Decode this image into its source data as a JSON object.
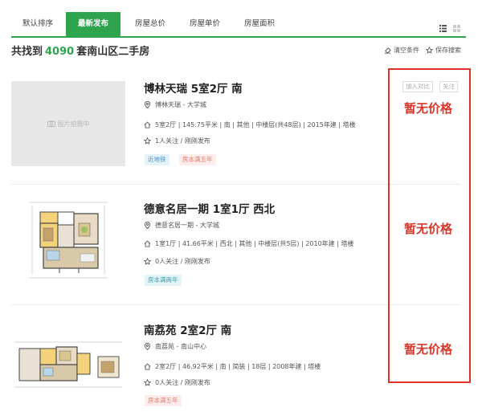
{
  "sort_tabs": [
    {
      "label": "默认排序"
    },
    {
      "label": "最新发布"
    },
    {
      "label": "房屋总价"
    },
    {
      "label": "房屋单价"
    },
    {
      "label": "房屋面积"
    }
  ],
  "summary": {
    "prefix": "共找到",
    "count": "4090",
    "suffix": "套南山区二手房"
  },
  "tools": {
    "clear": "清空条件",
    "save": "保存搜索"
  },
  "placeholder_text": "图片拍摄中",
  "listings": [
    {
      "title": "博林天瑞 5室2厅 南",
      "location": "博林天瑞 - 大学城",
      "info": "5室2厅 | 145.75平米 | 南 | 其他 | 中楼层(共48层) | 2015年建 | 塔楼",
      "follow": "1人关注 / 刚刚发布",
      "tags": [
        "近地铁",
        "房本满五年"
      ],
      "compare": "加入对比",
      "attention": "关注",
      "price": "暂无价格"
    },
    {
      "title": "德意名居一期 1室1厅 西北",
      "location": "德意名居一期 - 大学城",
      "info": "1室1厅 | 41.66平米 | 西北 | 其他 | 中楼层(共5层) | 2010年建 | 塔楼",
      "follow": "0人关注 / 刚刚发布",
      "tags": [
        "房本满两年"
      ],
      "price": "暂无价格"
    },
    {
      "title": "南荔苑 2室2厅 南",
      "location": "南荔苑 - 南山中心",
      "info": "2室2厅 | 46.92平米 | 南 | 简装 | 18层 | 2008年建 | 塔楼",
      "follow": "0人关注 / 刚刚发布",
      "tags": [
        "房本满五年"
      ],
      "price": "暂无价格"
    }
  ],
  "colors": {
    "accent": "#2ea44f",
    "price": "#d9372c",
    "highlight": "#e0302a"
  }
}
